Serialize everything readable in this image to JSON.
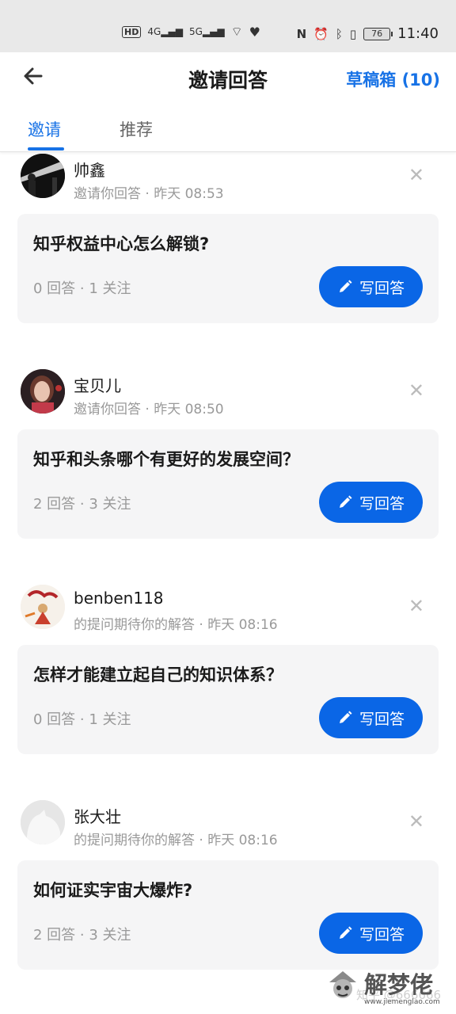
{
  "status_bar": {
    "left_chips": [
      "HD",
      "4G",
      "5G"
    ],
    "battery": "76",
    "time": "11:40"
  },
  "header": {
    "title": "邀请回答",
    "drafts_label": "草稿箱 (10)"
  },
  "tabs": [
    {
      "label": "邀请",
      "active": true
    },
    {
      "label": "推荐",
      "active": false
    }
  ],
  "items": [
    {
      "user": "帅鑫",
      "meta": "邀请你回答 · 昨天 08:53",
      "question": "知乎权益中心怎么解锁?",
      "stats": "0 回答 · 1 关注",
      "button": "写回答"
    },
    {
      "user": "宝贝儿",
      "meta": "邀请你回答 · 昨天 08:50",
      "question": "知乎和头条哪个有更好的发展空间？",
      "stats": "2 回答 · 3 关注",
      "button": "写回答"
    },
    {
      "user": "benben118",
      "meta": "的提问期待你的解答 · 昨天 08:16",
      "question": "怎样才能建立起自己的知识体系？",
      "stats": "0 回答 · 1 关注",
      "button": "写回答"
    },
    {
      "user": "张大壮",
      "meta": "的提问期待你的解答 · 昨天 08:16",
      "question": "如何证实宇宙大爆炸?",
      "stats": "2 回答 · 3 关注",
      "button": "写回答"
    }
  ],
  "watermark": {
    "text": "解梦佬",
    "url": "www.jiemenglao.com",
    "faint": "知乎 @666666"
  },
  "colors": {
    "accent": "#1772e6",
    "button": "#0a66e6",
    "card": "#f5f5f6"
  }
}
